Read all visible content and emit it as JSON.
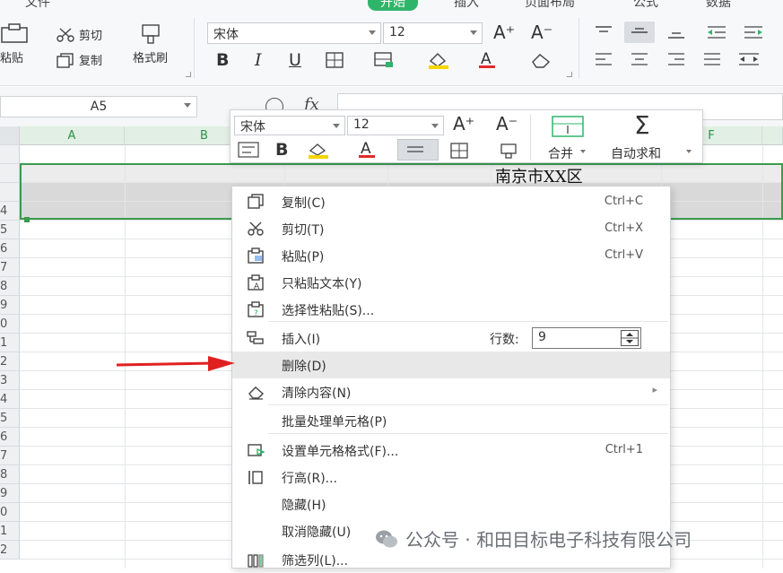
{
  "ribbon": {
    "menu": [
      "文件",
      "开始",
      "插入",
      "页面布局",
      "公式",
      "数据"
    ],
    "cut_label": "剪切",
    "copy_label": "复制",
    "paste_label": "粘贴",
    "format_painter_label": "格式刷",
    "font_name": "宋体",
    "font_size": "12"
  },
  "formula_bar": {
    "name_box": "A5",
    "fx": "fx"
  },
  "sheet": {
    "columns": [
      "A",
      "B",
      "F"
    ],
    "row_numbers": [
      "",
      "",
      "",
      "4",
      "5",
      "6",
      "7",
      "8",
      "9",
      "0",
      "1",
      "2",
      "3",
      "4",
      "5",
      "6",
      "7",
      "8",
      "9",
      "0",
      "1",
      "2"
    ],
    "cell_text": "南京市XX区",
    "accent": "#3a9b4f"
  },
  "mini_toolbar": {
    "font_name": "宋体",
    "font_size": "12",
    "merge_label": "合并",
    "autosum_label": "自动求和"
  },
  "context_menu": {
    "items": [
      {
        "label": "复制(C)",
        "shortcut": "Ctrl+C",
        "icon": "copy-icon"
      },
      {
        "label": "剪切(T)",
        "shortcut": "Ctrl+X",
        "icon": "scissors-icon"
      },
      {
        "label": "粘贴(P)",
        "shortcut": "Ctrl+V",
        "icon": "paste-icon"
      },
      {
        "label": "只粘贴文本(Y)",
        "icon": "paste-text-icon"
      },
      {
        "label": "选择性粘贴(S)...",
        "icon": "paste-special-icon"
      },
      {
        "label": "插入(I)",
        "icon": "insert-icon"
      },
      {
        "label": "删除(D)"
      },
      {
        "label": "清除内容(N)",
        "icon": "eraser-icon",
        "submenu": "▸"
      },
      {
        "label": "批量处理单元格(P)"
      },
      {
        "label": "设置单元格格式(F)...",
        "shortcut": "Ctrl+1",
        "icon": "format-cells-icon"
      },
      {
        "label": "行高(R)...",
        "icon": "row-height-icon"
      },
      {
        "label": "隐藏(H)"
      },
      {
        "label": "取消隐藏(U)"
      },
      {
        "label": "筛选列(L)...",
        "icon": "filter-columns-icon"
      }
    ],
    "row_count_label": "行数:",
    "row_count_value": "9"
  },
  "watermark": "公众号 · 和田目标电子科技有限公司"
}
